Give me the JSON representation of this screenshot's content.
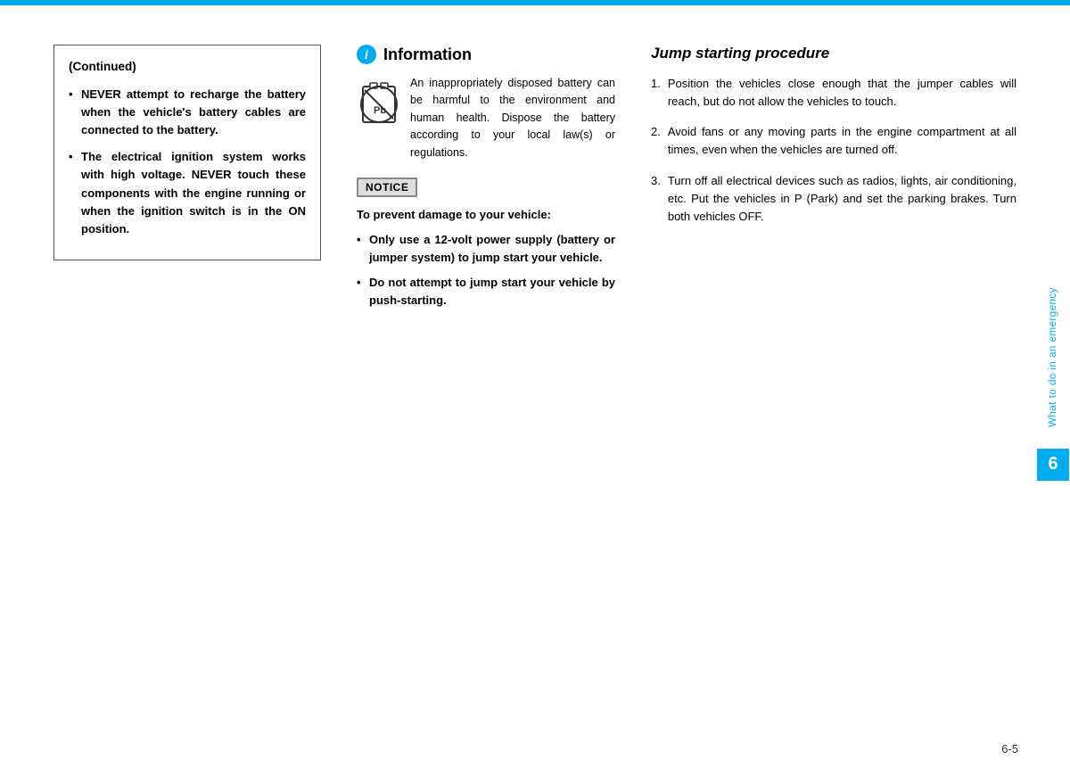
{
  "topLines": {
    "primary": "#00adef",
    "secondary": "#00adef"
  },
  "leftColumn": {
    "continued_title": "(Continued)",
    "bullets": [
      "NEVER attempt to recharge the battery when the vehicle's battery cables are connected to the battery.",
      "The electrical ignition system works with high voltage. NEVER touch these components with the engine running or when the ignition switch is in the ON position."
    ]
  },
  "middleColumn": {
    "info_title": "Information",
    "info_icon_label": "i",
    "info_text": "An inappropriately disposed battery can be harmful to the environment and human health. Dispose the battery according to your local law(s) or regulations.",
    "notice_label": "NOTICE",
    "notice_intro": "To prevent damage to your vehicle:",
    "notice_bullets": [
      "Only use a 12-volt power supply (battery or jumper system) to jump start your vehicle.",
      "Do not attempt to jump start your vehicle by push-starting."
    ]
  },
  "rightColumn": {
    "jump_title": "Jump starting procedure",
    "steps": [
      "Position the vehicles close enough that the jumper cables will reach, but do not allow the vehicles to touch.",
      "Avoid fans or any moving parts in the engine compartment at all times, even when the vehicles are turned off.",
      "Turn off all electrical devices such as radios, lights, air conditioning, etc. Put the vehicles in P (Park) and set the parking brakes. Turn both vehicles OFF."
    ]
  },
  "sidebar": {
    "text": "What to do in an emergency",
    "chapter_number": "6"
  },
  "page_number": "6-5"
}
